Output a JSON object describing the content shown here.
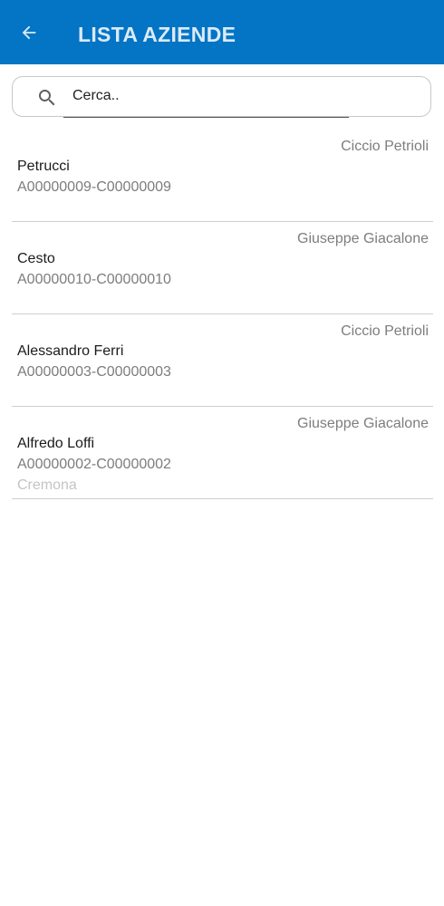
{
  "header": {
    "title": "LISTA AZIENDE",
    "back_icon": "arrow-left-icon",
    "background": "#0474c4"
  },
  "search": {
    "placeholder": "Cerca..",
    "icon": "search-icon"
  },
  "companies": [
    {
      "agent": "Ciccio Petrioli",
      "name": "Petrucci",
      "code": "A00000009-C00000009",
      "city": ""
    },
    {
      "agent": "Giuseppe Giacalone",
      "name": "Cesto",
      "code": "A00000010-C00000010",
      "city": ""
    },
    {
      "agent": "Ciccio Petrioli",
      "name": "Alessandro Ferri",
      "code": "A00000003-C00000003",
      "city": ""
    },
    {
      "agent": "Giuseppe Giacalone",
      "name": "Alfredo Loffi",
      "code": "A00000002-C00000002",
      "city": "Cremona"
    }
  ]
}
